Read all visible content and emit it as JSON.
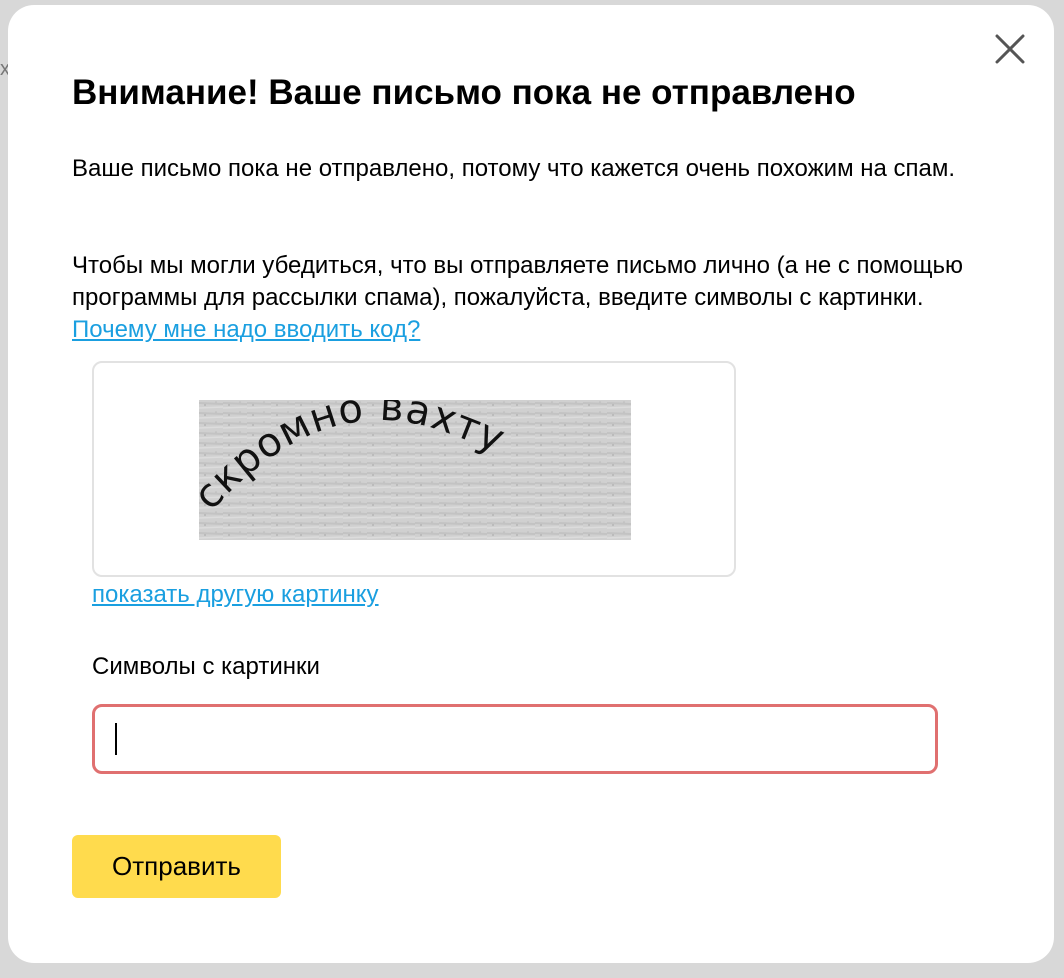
{
  "modal": {
    "title": "Внимание! Ваше письмо пока не отправлено",
    "paragraph_1": "Ваше письмо пока не отправлено, потому что кажется очень похожим на спам.",
    "paragraph_2_text": "Чтобы мы могли убедиться, что вы отправляете письмо лично (а не с помощью программы для рассылки спама), пожалуйста, введите символы с картинки.",
    "why_link": "Почему мне надо вводить код?",
    "captcha": {
      "word_1": "скромно",
      "word_2": "вахту"
    },
    "reload_link": "показать другую картинку",
    "field_label": "Символы с картинки",
    "input_value": "",
    "submit_label": "Отправить",
    "close_icon": "close-icon"
  },
  "colors": {
    "link": "#1a9fe0",
    "input_error_border": "#e07070",
    "submit_bg": "#ffdb4d"
  }
}
